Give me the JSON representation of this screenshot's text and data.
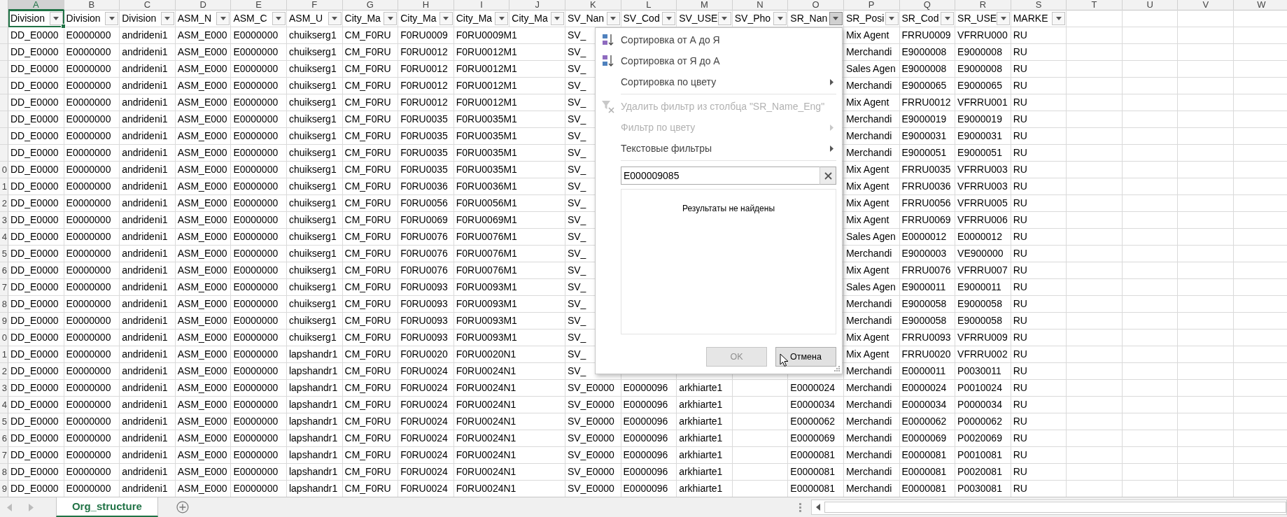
{
  "column_letters": [
    {
      "label": "A",
      "selected": true
    },
    {
      "label": "B",
      "selected": false
    },
    {
      "label": "C",
      "selected": false
    },
    {
      "label": "D",
      "selected": false
    },
    {
      "label": "E",
      "selected": false
    },
    {
      "label": "F",
      "selected": false
    },
    {
      "label": "G",
      "selected": false
    },
    {
      "label": "H",
      "selected": false
    },
    {
      "label": "I",
      "selected": false,
      "spills": true
    },
    {
      "label": "J",
      "selected": false
    },
    {
      "label": "K",
      "selected": false
    },
    {
      "label": "L",
      "selected": false
    },
    {
      "label": "M",
      "selected": false
    },
    {
      "label": "N",
      "selected": false
    },
    {
      "label": "O",
      "selected": false
    },
    {
      "label": "P",
      "selected": false
    },
    {
      "label": "Q",
      "selected": false
    },
    {
      "label": "R",
      "selected": false
    },
    {
      "label": "S",
      "selected": false
    },
    {
      "label": "T",
      "selected": false
    },
    {
      "label": "U",
      "selected": false
    },
    {
      "label": "V",
      "selected": false
    },
    {
      "label": "W",
      "selected": false
    }
  ],
  "header_row": [
    {
      "label": "Division",
      "filter_open": false
    },
    {
      "label": "Division",
      "filter_open": false
    },
    {
      "label": "Division",
      "filter_open": false
    },
    {
      "label": "ASM_N",
      "filter_open": false
    },
    {
      "label": "ASM_C",
      "filter_open": false
    },
    {
      "label": "ASM_U",
      "filter_open": false
    },
    {
      "label": "City_Ma",
      "filter_open": false
    },
    {
      "label": "City_Ma",
      "filter_open": false
    },
    {
      "label": "City_Ma",
      "filter_open": false
    },
    {
      "label": "City_Ma",
      "filter_open": false
    },
    {
      "label": "SV_Nan",
      "filter_open": false
    },
    {
      "label": "SV_Cod",
      "filter_open": false
    },
    {
      "label": "SV_USE",
      "filter_open": false
    },
    {
      "label": "SV_Pho",
      "filter_open": false
    },
    {
      "label": "SR_Nan",
      "filter_open": true
    },
    {
      "label": "SR_Posi",
      "filter_open": false
    },
    {
      "label": "SR_Cod",
      "filter_open": false
    },
    {
      "label": "SR_USE",
      "filter_open": false
    },
    {
      "label": "MARKE",
      "filter_open": false
    }
  ],
  "rows": [
    {
      "cells": {
        "A": "DD_E0000",
        "B": "E0000000",
        "C": "andrideni1",
        "D": "ASM_E000",
        "E": "E0000000",
        "F": "chuikserg1",
        "G": "CM_F0RU",
        "H": "F0RU0009",
        "I": "F0RU0009M1",
        "K": "SV_",
        "P": "Mix Agent",
        "Q": "FRRU0009",
        "R": "VFRRU000",
        "S": "RU"
      }
    },
    {
      "cells": {
        "A": "DD_E0000",
        "B": "E0000000",
        "C": "andrideni1",
        "D": "ASM_E000",
        "E": "E0000000",
        "F": "chuikserg1",
        "G": "CM_F0RU",
        "H": "F0RU0012",
        "I": "F0RU0012M1",
        "K": "SV_",
        "P": "Merchandi",
        "Q": "E9000008",
        "R": "E9000008",
        "S": "RU"
      }
    },
    {
      "cells": {
        "A": "DD_E0000",
        "B": "E0000000",
        "C": "andrideni1",
        "D": "ASM_E000",
        "E": "E0000000",
        "F": "chuikserg1",
        "G": "CM_F0RU",
        "H": "F0RU0012",
        "I": "F0RU0012M1",
        "K": "SV_",
        "P": "Sales Agen",
        "Q": "E9000008",
        "R": "E9000008",
        "S": "RU"
      }
    },
    {
      "cells": {
        "A": "DD_E0000",
        "B": "E0000000",
        "C": "andrideni1",
        "D": "ASM_E000",
        "E": "E0000000",
        "F": "chuikserg1",
        "G": "CM_F0RU",
        "H": "F0RU0012",
        "I": "F0RU0012M1",
        "K": "SV_",
        "P": "Merchandi",
        "Q": "E9000065",
        "R": "E9000065",
        "S": "RU"
      }
    },
    {
      "cells": {
        "A": "DD_E0000",
        "B": "E0000000",
        "C": "andrideni1",
        "D": "ASM_E000",
        "E": "E0000000",
        "F": "chuikserg1",
        "G": "CM_F0RU",
        "H": "F0RU0012",
        "I": "F0RU0012M1",
        "K": "SV_",
        "P": "Mix Agent",
        "Q": "FRRU0012",
        "R": "VFRRU001",
        "S": "RU"
      }
    },
    {
      "cells": {
        "A": "DD_E0000",
        "B": "E0000000",
        "C": "andrideni1",
        "D": "ASM_E000",
        "E": "E0000000",
        "F": "chuikserg1",
        "G": "CM_F0RU",
        "H": "F0RU0035",
        "I": "F0RU0035M1",
        "K": "SV_",
        "P": "Merchandi",
        "Q": "E9000019",
        "R": "E9000019",
        "S": "RU"
      }
    },
    {
      "cells": {
        "A": "DD_E0000",
        "B": "E0000000",
        "C": "andrideni1",
        "D": "ASM_E000",
        "E": "E0000000",
        "F": "chuikserg1",
        "G": "CM_F0RU",
        "H": "F0RU0035",
        "I": "F0RU0035M1",
        "K": "SV_",
        "P": "Merchandi",
        "Q": "E9000031",
        "R": "E9000031",
        "S": "RU"
      }
    },
    {
      "cells": {
        "A": "DD_E0000",
        "B": "E0000000",
        "C": "andrideni1",
        "D": "ASM_E000",
        "E": "E0000000",
        "F": "chuikserg1",
        "G": "CM_F0RU",
        "H": "F0RU0035",
        "I": "F0RU0035M1",
        "K": "SV_",
        "P": "Merchandi",
        "Q": "E9000051",
        "R": "E9000051",
        "S": "RU"
      }
    },
    {
      "label": "0",
      "cells": {
        "A": "DD_E0000",
        "B": "E0000000",
        "C": "andrideni1",
        "D": "ASM_E000",
        "E": "E0000000",
        "F": "chuikserg1",
        "G": "CM_F0RU",
        "H": "F0RU0035",
        "I": "F0RU0035M1",
        "K": "SV_",
        "P": "Mix Agent",
        "Q": "FRRU0035",
        "R": "VFRRU003",
        "S": "RU"
      }
    },
    {
      "label": "1",
      "cells": {
        "A": "DD_E0000",
        "B": "E0000000",
        "C": "andrideni1",
        "D": "ASM_E000",
        "E": "E0000000",
        "F": "chuikserg1",
        "G": "CM_F0RU",
        "H": "F0RU0036",
        "I": "F0RU0036M1",
        "K": "SV_",
        "P": "Mix Agent",
        "Q": "FRRU0036",
        "R": "VFRRU003",
        "S": "RU"
      }
    },
    {
      "label": "2",
      "cells": {
        "A": "DD_E0000",
        "B": "E0000000",
        "C": "andrideni1",
        "D": "ASM_E000",
        "E": "E0000000",
        "F": "chuikserg1",
        "G": "CM_F0RU",
        "H": "F0RU0056",
        "I": "F0RU0056M1",
        "K": "SV_",
        "P": "Mix Agent",
        "Q": "FRRU0056",
        "R": "VFRRU005",
        "S": "RU"
      }
    },
    {
      "label": "3",
      "cells": {
        "A": "DD_E0000",
        "B": "E0000000",
        "C": "andrideni1",
        "D": "ASM_E000",
        "E": "E0000000",
        "F": "chuikserg1",
        "G": "CM_F0RU",
        "H": "F0RU0069",
        "I": "F0RU0069M1",
        "K": "SV_",
        "P": "Mix Agent",
        "Q": "FRRU0069",
        "R": "VFRRU006",
        "S": "RU"
      }
    },
    {
      "label": "4",
      "cells": {
        "A": "DD_E0000",
        "B": "E0000000",
        "C": "andrideni1",
        "D": "ASM_E000",
        "E": "E0000000",
        "F": "chuikserg1",
        "G": "CM_F0RU",
        "H": "F0RU0076",
        "I": "F0RU0076M1",
        "K": "SV_",
        "P": "Sales Agen",
        "Q": "E0000012",
        "R": "E0000012",
        "S": "RU"
      }
    },
    {
      "label": "5",
      "cells": {
        "A": "DD_E0000",
        "B": "E0000000",
        "C": "andrideni1",
        "D": "ASM_E000",
        "E": "E0000000",
        "F": "chuikserg1",
        "G": "CM_F0RU",
        "H": "F0RU0076",
        "I": "F0RU0076M1",
        "K": "SV_",
        "P": "Merchandi",
        "Q": "E9000003",
        "R": "VE900000",
        "S": "RU"
      }
    },
    {
      "label": "6",
      "cells": {
        "A": "DD_E0000",
        "B": "E0000000",
        "C": "andrideni1",
        "D": "ASM_E000",
        "E": "E0000000",
        "F": "chuikserg1",
        "G": "CM_F0RU",
        "H": "F0RU0076",
        "I": "F0RU0076M1",
        "K": "SV_",
        "P": "Mix Agent",
        "Q": "FRRU0076",
        "R": "VFRRU007",
        "S": "RU"
      }
    },
    {
      "label": "7",
      "cells": {
        "A": "DD_E0000",
        "B": "E0000000",
        "C": "andrideni1",
        "D": "ASM_E000",
        "E": "E0000000",
        "F": "chuikserg1",
        "G": "CM_F0RU",
        "H": "F0RU0093",
        "I": "F0RU0093M1",
        "K": "SV_",
        "P": "Sales Agen",
        "Q": "E9000011",
        "R": "E9000011",
        "S": "RU"
      }
    },
    {
      "label": "8",
      "cells": {
        "A": "DD_E0000",
        "B": "E0000000",
        "C": "andrideni1",
        "D": "ASM_E000",
        "E": "E0000000",
        "F": "chuikserg1",
        "G": "CM_F0RU",
        "H": "F0RU0093",
        "I": "F0RU0093M1",
        "K": "SV_",
        "P": "Merchandi",
        "Q": "E9000058",
        "R": "E9000058",
        "S": "RU"
      }
    },
    {
      "label": "9",
      "cells": {
        "A": "DD_E0000",
        "B": "E0000000",
        "C": "andrideni1",
        "D": "ASM_E000",
        "E": "E0000000",
        "F": "chuikserg1",
        "G": "CM_F0RU",
        "H": "F0RU0093",
        "I": "F0RU0093M1",
        "K": "SV_",
        "P": "Merchandi",
        "Q": "E9000058",
        "R": "E9000058",
        "S": "RU"
      }
    },
    {
      "label": "0",
      "cells": {
        "A": "DD_E0000",
        "B": "E0000000",
        "C": "andrideni1",
        "D": "ASM_E000",
        "E": "E0000000",
        "F": "chuikserg1",
        "G": "CM_F0RU",
        "H": "F0RU0093",
        "I": "F0RU0093M1",
        "K": "SV_",
        "P": "Mix Agent",
        "Q": "FRRU0093",
        "R": "VFRRU009",
        "S": "RU"
      }
    },
    {
      "label": "1",
      "cells": {
        "A": "DD_E0000",
        "B": "E0000000",
        "C": "andrideni1",
        "D": "ASM_E000",
        "E": "E0000000",
        "F": "lapshandr1",
        "G": "CM_F0RU",
        "H": "F0RU0020",
        "I": "F0RU0020N1",
        "K": "SV_",
        "P": "Mix Agent",
        "Q": "FRRU0020",
        "R": "VFRRU002",
        "S": "RU"
      }
    },
    {
      "label": "2",
      "cells": {
        "A": "DD_E0000",
        "B": "E0000000",
        "C": "andrideni1",
        "D": "ASM_E000",
        "E": "E0000000",
        "F": "lapshandr1",
        "G": "CM_F0RU",
        "H": "F0RU0024",
        "I": "F0RU0024N1",
        "K": "SV_",
        "P": "Merchandi",
        "Q": "E0000011",
        "R": "P0030011",
        "S": "RU"
      }
    },
    {
      "label": "3",
      "cells": {
        "A": "DD_E0000",
        "B": "E0000000",
        "C": "andrideni1",
        "D": "ASM_E000",
        "E": "E0000000",
        "F": "lapshandr1",
        "G": "CM_F0RU",
        "H": "F0RU0024",
        "I": "F0RU0024N1",
        "K": "SV_E0000",
        "L": "E0000096",
        "M": "arkhiarte1",
        "O": "E0000024",
        "P": "Merchandi",
        "Q": "E0000024",
        "R": "P0010024",
        "S": "RU"
      }
    },
    {
      "label": "4",
      "cells": {
        "A": "DD_E0000",
        "B": "E0000000",
        "C": "andrideni1",
        "D": "ASM_E000",
        "E": "E0000000",
        "F": "lapshandr1",
        "G": "CM_F0RU",
        "H": "F0RU0024",
        "I": "F0RU0024N1",
        "K": "SV_E0000",
        "L": "E0000096",
        "M": "arkhiarte1",
        "O": "E0000034",
        "P": "Merchandi",
        "Q": "E0000034",
        "R": "P0000034",
        "S": "RU"
      }
    },
    {
      "label": "5",
      "cells": {
        "A": "DD_E0000",
        "B": "E0000000",
        "C": "andrideni1",
        "D": "ASM_E000",
        "E": "E0000000",
        "F": "lapshandr1",
        "G": "CM_F0RU",
        "H": "F0RU0024",
        "I": "F0RU0024N1",
        "K": "SV_E0000",
        "L": "E0000096",
        "M": "arkhiarte1",
        "O": "E0000062",
        "P": "Merchandi",
        "Q": "E0000062",
        "R": "P0000062",
        "S": "RU"
      }
    },
    {
      "label": "6",
      "cells": {
        "A": "DD_E0000",
        "B": "E0000000",
        "C": "andrideni1",
        "D": "ASM_E000",
        "E": "E0000000",
        "F": "lapshandr1",
        "G": "CM_F0RU",
        "H": "F0RU0024",
        "I": "F0RU0024N1",
        "K": "SV_E0000",
        "L": "E0000096",
        "M": "arkhiarte1",
        "O": "E0000069",
        "P": "Merchandi",
        "Q": "E0000069",
        "R": "P0020069",
        "S": "RU"
      }
    },
    {
      "label": "7",
      "cells": {
        "A": "DD_E0000",
        "B": "E0000000",
        "C": "andrideni1",
        "D": "ASM_E000",
        "E": "E0000000",
        "F": "lapshandr1",
        "G": "CM_F0RU",
        "H": "F0RU0024",
        "I": "F0RU0024N1",
        "K": "SV_E0000",
        "L": "E0000096",
        "M": "arkhiarte1",
        "O": "E0000081",
        "P": "Merchandi",
        "Q": "E0000081",
        "R": "P0010081",
        "S": "RU"
      }
    },
    {
      "label": "8",
      "cells": {
        "A": "DD_E0000",
        "B": "E0000000",
        "C": "andrideni1",
        "D": "ASM_E000",
        "E": "E0000000",
        "F": "lapshandr1",
        "G": "CM_F0RU",
        "H": "F0RU0024",
        "I": "F0RU0024N1",
        "K": "SV_E0000",
        "L": "E0000096",
        "M": "arkhiarte1",
        "O": "E0000081",
        "P": "Merchandi",
        "Q": "E0000081",
        "R": "P0020081",
        "S": "RU"
      }
    },
    {
      "label": "9",
      "cells": {
        "A": "DD_E0000",
        "B": "E0000000",
        "C": "andrideni1",
        "D": "ASM_E000",
        "E": "E0000000",
        "F": "lapshandr1",
        "G": "CM_F0RU",
        "H": "F0RU0024",
        "I": "F0RU0024N1",
        "K": "SV_E0000",
        "L": "E0000096",
        "M": "arkhiarte1",
        "O": "E0000081",
        "P": "Merchandi",
        "Q": "E0000081",
        "R": "P0030081",
        "S": "RU"
      }
    }
  ],
  "filter_menu": {
    "items": [
      {
        "kind": "sort-asc",
        "label": "Сортировка от А до Я",
        "disabled": false,
        "submenu": false
      },
      {
        "kind": "sort-desc",
        "label": "Сортировка от Я до А",
        "disabled": false,
        "submenu": false
      },
      {
        "kind": "plain",
        "label": "Сортировка по цвету",
        "disabled": false,
        "submenu": true
      },
      {
        "kind": "separator"
      },
      {
        "kind": "clear-filter",
        "label": "Удалить фильтр из столбца \"SR_Name_Eng\"",
        "disabled": true,
        "submenu": false
      },
      {
        "kind": "plain",
        "label": "Фильтр по цвету",
        "disabled": true,
        "submenu": true
      },
      {
        "kind": "plain",
        "label": "Текстовые фильтры",
        "disabled": false,
        "submenu": true
      },
      {
        "kind": "separator"
      }
    ],
    "search": {
      "value": "E000009085"
    },
    "results_message": "Результаты не найдены",
    "buttons": [
      {
        "label": "OK",
        "disabled": true
      },
      {
        "label": "Отмена",
        "disabled": false
      }
    ]
  },
  "sheet_tabs": [
    {
      "label": "Org_structure",
      "selected": true
    }
  ]
}
